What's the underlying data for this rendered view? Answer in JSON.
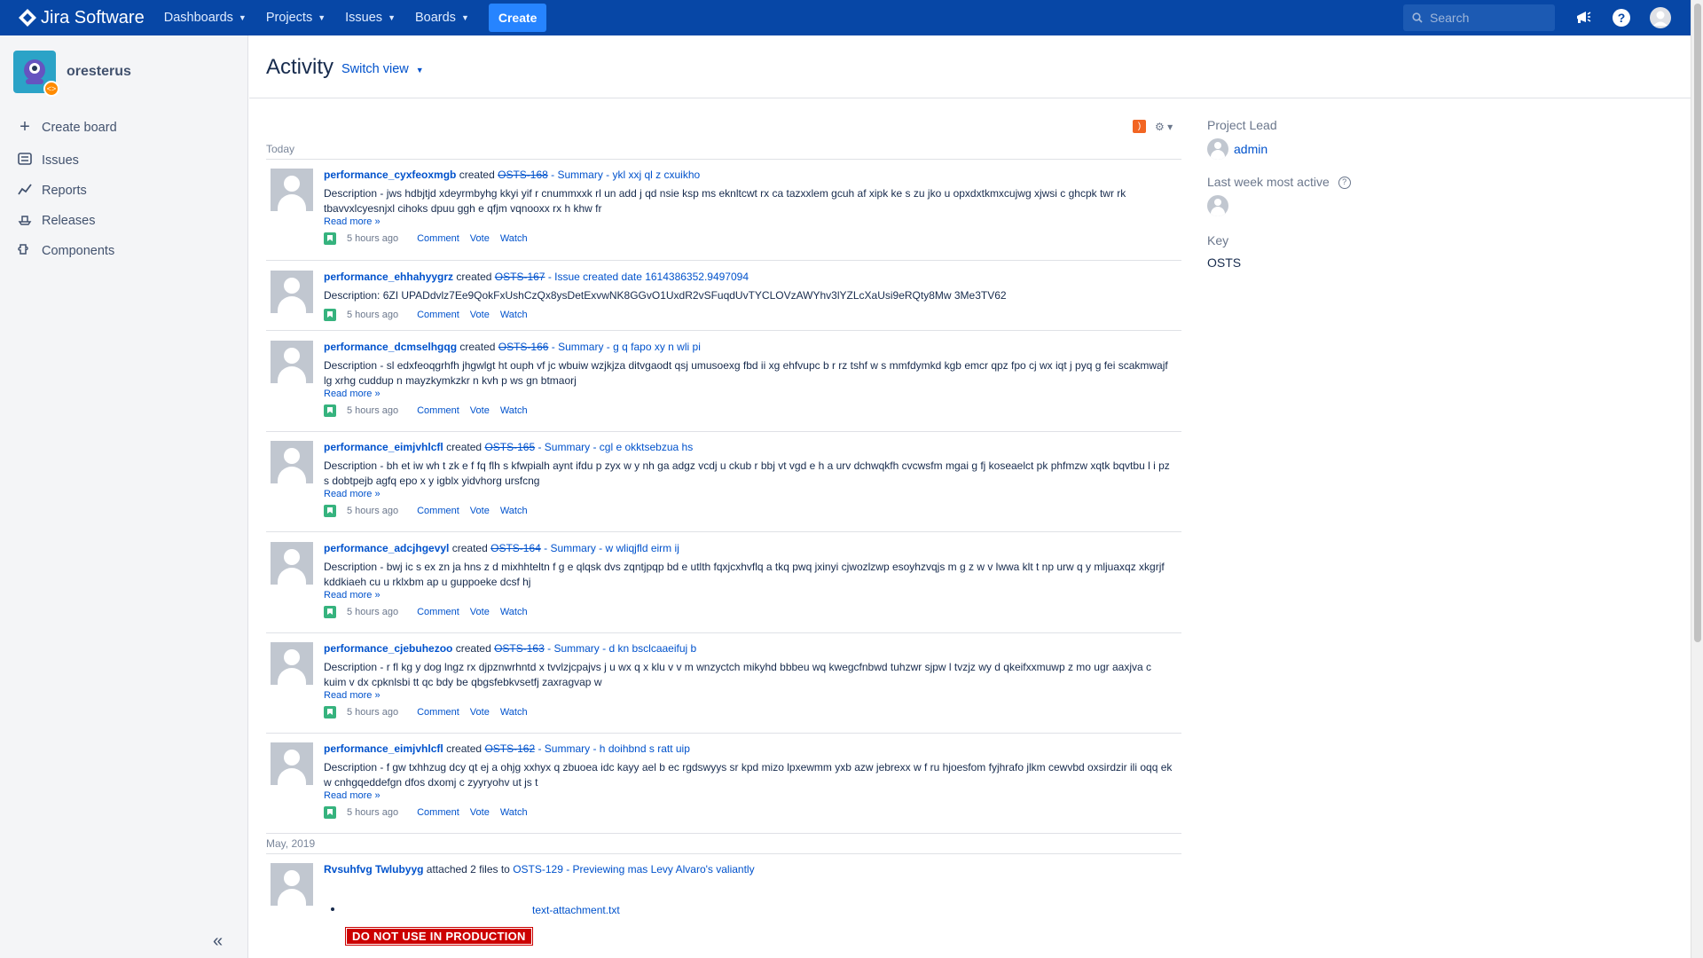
{
  "nav": {
    "brand": "Jira Software",
    "items": [
      {
        "label": "Dashboards"
      },
      {
        "label": "Projects"
      },
      {
        "label": "Issues"
      },
      {
        "label": "Boards"
      }
    ],
    "create_label": "Create",
    "search_placeholder": "Search"
  },
  "sidebar": {
    "project_name": "oresterus",
    "items": [
      {
        "label": "Create board",
        "icon": "plus-icon"
      },
      {
        "label": "Issues",
        "icon": "issues-icon"
      },
      {
        "label": "Reports",
        "icon": "reports-icon"
      },
      {
        "label": "Releases",
        "icon": "releases-icon"
      },
      {
        "label": "Components",
        "icon": "components-icon"
      }
    ]
  },
  "page": {
    "title": "Activity",
    "switch_view": "Switch view"
  },
  "groups": [
    {
      "label": "Today"
    },
    {
      "label": "May, 2019"
    }
  ],
  "entries": [
    {
      "actor": "performance_cyxfeoxmgb",
      "verb": "created",
      "key": "OSTS-168",
      "summary": " - Summary - ykl xxj ql z cxuikho",
      "description": "Description - jws hdbjtjd xdeyrmbyhg kkyi yif r cnummxxk rl un add j qd nsie ksp ms eknltcwt rx ca tazxxlem gcuh af xipk ke s zu jko u opxdxtkmxcujwg xjwsi c ghcpk twr rk tbavvxlcyesnjxl cihoks dpuu ggh e qfjm vqnooxx rx h khw fr",
      "read_more": "Read more »",
      "time": "5 hours ago"
    },
    {
      "actor": "performance_ehhahyygrz",
      "verb": "created",
      "key": "OSTS-167",
      "summary": " - Issue created date 1614386352.9497094",
      "description": "Description: 6ZI UPADdvlz7Ee9QokFxUshCzQx8ysDetExvwNK8GGvO1UxdR2vSFuqdUvTYCLOVzAWYhv3lYZLcXaUsi9eRQty8Mw 3Me3TV62",
      "read_more": "",
      "time": "5 hours ago"
    },
    {
      "actor": "performance_dcmselhgqg",
      "verb": "created",
      "key": "OSTS-166",
      "summary": " - Summary - g q fapo xy n wli pi",
      "description": "Description - sl edxfeoqgrhfh jhgwlgt ht ouph vf jc wbuiw wzjkjza ditvgaodt qsj umusoexg fbd ii xg ehfvupc b r rz tshf w s mmfdymkd kgb emcr qpz fpo cj wx iqt j pyq g fei scakmwajf lg xrhg cuddup n mayzkymkzkr n kvh p ws gn btmaorj",
      "read_more": "Read more »",
      "time": "5 hours ago"
    },
    {
      "actor": "performance_eimjvhlcfl",
      "verb": "created",
      "key": "OSTS-165",
      "summary": " - Summary - cgl e okktsebzua hs",
      "description": "Description - bh et iw wh t zk e f fq flh s kfwpialh aynt ifdu p zyx w y nh ga adgz vcdj u ckub r bbj vt vgd e h a urv dchwqkfh cvcwsfm mgai g fj koseaelct pk phfmzw xqtk bqvtbu l i pz s dobtpejb agfq epo x y igblx yidvhorg ursfcng",
      "read_more": "Read more »",
      "time": "5 hours ago"
    },
    {
      "actor": "performance_adcjhgevyl",
      "verb": "created",
      "key": "OSTS-164",
      "summary": " - Summary - w wliqjfld eirm ij",
      "description": "Description - bwj ic s ex zn ja hns z d mixhhteltn f g e qlqsk dvs zqntjpqp bd e utlth fqxjcxhvflq a tkq pwq jxinyi cjwozlzwp esoyhzvqjs m g z w v lwwa klt t np urw q y mljuaxqz xkgrjf kddkiaeh cu u rklxbm ap u guppoeke dcsf hj",
      "read_more": "Read more »",
      "time": "5 hours ago"
    },
    {
      "actor": "performance_cjebuhezoo",
      "verb": "created",
      "key": "OSTS-163",
      "summary": " - Summary - d kn bsclcaaeifuj b",
      "description": "Description - r fl kg y dog lngz rx djpznwrhntd x tvvlzjcpajvs j u wx q x klu v v m wnzyctch mikyhd bbbeu wq kwegcfnbwd tuhzwr sjpw l tvzjz wy d qkeifxxmuwp z mo ugr aaxjva c kuim v dx cpknlsbi tt qc bdy be qbgsfebkvsetfj zaxragvap w",
      "read_more": "Read more »",
      "time": "5 hours ago"
    },
    {
      "actor": "performance_eimjvhlcfl",
      "verb": "created",
      "key": "OSTS-162",
      "summary": " - Summary - h doihbnd s ratt uip",
      "description": "Description - f gw txhhzug dcy qt ej a ohjg xxhyx q zbuoea idc kayy ael b ec rgdswyys sr kpd mizo lpxewmm yxb azw jebrexx w f ru hjoesfom fyjhrafo jlkm cewvbd oxsirdzir ili oqq ek w cnhgqeddefgn dfos dxomj c zyyryohv ut js t",
      "read_more": "Read more »",
      "time": "5 hours ago"
    }
  ],
  "attach_entry": {
    "actor": "Rvsuhfvg Twlubyyg",
    "verb": "attached 2 files to",
    "target": "OSTS-129 - Previewing mas Levy Alvaro's valiantly",
    "file": "text-attachment.txt",
    "warning": "DO NOT USE IN PRODUCTION"
  },
  "actions": {
    "comment": "Comment",
    "vote": "Vote",
    "watch": "Watch"
  },
  "right_panel": {
    "project_lead_label": "Project Lead",
    "project_lead": "admin",
    "most_active_label": "Last week most active",
    "key_label": "Key",
    "key_value": "OSTS"
  },
  "colors": {
    "nav_bg": "#0747a6",
    "create_btn": "#2684ff",
    "link": "#0052cc",
    "story_icon": "#36b37e",
    "warning": "#cc0000"
  }
}
